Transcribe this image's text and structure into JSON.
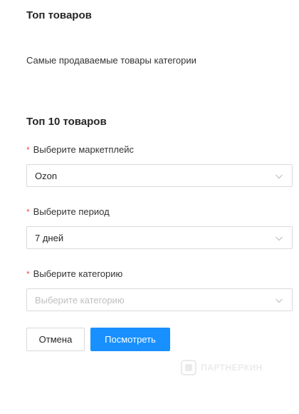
{
  "header": {
    "title": "Топ товаров",
    "subtitle": "Самые продаваемые товары категории"
  },
  "form": {
    "section_title": "Топ 10 товаров",
    "required_mark": "*",
    "marketplace": {
      "label": "Выберите маркетплейс",
      "value": "Ozon"
    },
    "period": {
      "label": "Выберите период",
      "value": "7 дней"
    },
    "category": {
      "label": "Выберите категорию",
      "value": "",
      "placeholder": "Выберите категорию"
    }
  },
  "actions": {
    "cancel_label": "Отмена",
    "submit_label": "Посмотреть"
  },
  "watermark": {
    "text": "ПАРТНЕРКИН"
  },
  "colors": {
    "primary": "#1890ff",
    "required": "#ff4d4f",
    "border": "#d9d9d9",
    "placeholder": "#bfbfbf"
  }
}
